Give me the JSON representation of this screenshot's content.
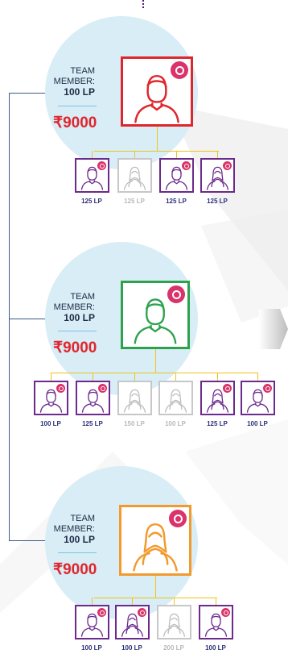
{
  "colors": {
    "tree_line": "#3c5a8c",
    "connector": "#f0c419",
    "circle": "#d8edf6",
    "amount": "#e0262d",
    "badge": "#d9336a",
    "purple": "#6b2a8c",
    "faded": "#c7c7c7",
    "red": "#e0262d",
    "green": "#2ca24d",
    "orange": "#f29a2e"
  },
  "teams": [
    {
      "label_line1": "TEAM",
      "label_line2": "MEMBER:",
      "lp": "100 LP",
      "amount": "₹9000",
      "avatar_color": "red",
      "avatar_icon": "male-user-icon",
      "children": [
        {
          "lp": "125 LP",
          "icon": "male-user-icon",
          "active": true
        },
        {
          "lp": "125 LP",
          "icon": "female-user-icon",
          "active": false
        },
        {
          "lp": "125 LP",
          "icon": "male-user-icon",
          "active": true
        },
        {
          "lp": "125 LP",
          "icon": "female-user-icon",
          "active": true
        }
      ]
    },
    {
      "label_line1": "TEAM",
      "label_line2": "MEMBER:",
      "lp": "100 LP",
      "amount": "₹9000",
      "avatar_color": "green",
      "avatar_icon": "male-user-icon",
      "children": [
        {
          "lp": "100 LP",
          "icon": "male-user-icon",
          "active": true
        },
        {
          "lp": "125 LP",
          "icon": "male-user-icon",
          "active": true
        },
        {
          "lp": "150 LP",
          "icon": "female-user-icon",
          "active": false
        },
        {
          "lp": "100 LP",
          "icon": "female-user-icon",
          "active": false
        },
        {
          "lp": "125 LP",
          "icon": "female-user-icon",
          "active": true
        },
        {
          "lp": "100 LP",
          "icon": "male-user-icon",
          "active": true
        }
      ]
    },
    {
      "label_line1": "TEAM",
      "label_line2": "MEMBER:",
      "lp": "100 LP",
      "amount": "₹9000",
      "avatar_color": "orange",
      "avatar_icon": "female-user-icon",
      "children": [
        {
          "lp": "100 LP",
          "icon": "male-user-icon",
          "active": true
        },
        {
          "lp": "100 LP",
          "icon": "female-user-icon",
          "active": true
        },
        {
          "lp": "200 LP",
          "icon": "female-user-icon",
          "active": false
        },
        {
          "lp": "100 LP",
          "icon": "male-user-icon",
          "active": true
        }
      ]
    }
  ]
}
